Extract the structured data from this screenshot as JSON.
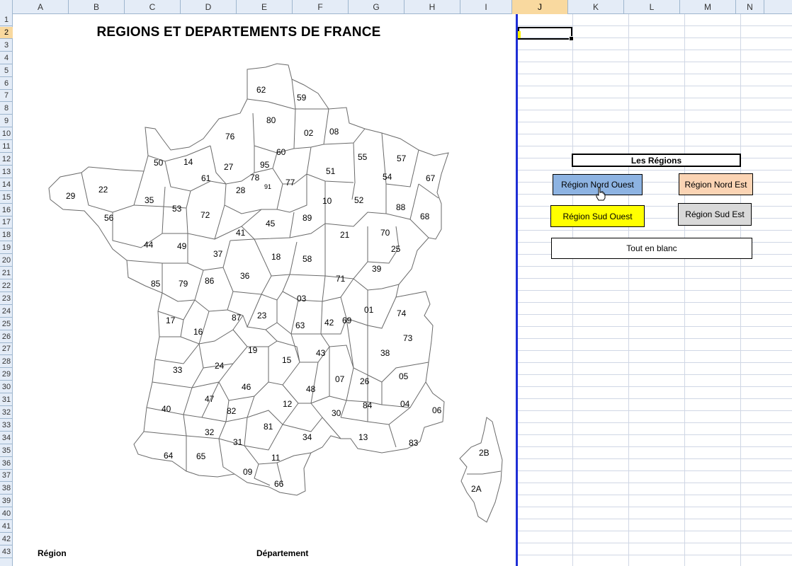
{
  "sheet": {
    "columns": [
      "A",
      "B",
      "C",
      "D",
      "E",
      "F",
      "G",
      "H",
      "I",
      "J",
      "K",
      "L",
      "M",
      "N"
    ],
    "selected_column": "J",
    "rows": [
      "1",
      "2",
      "3",
      "4",
      "5",
      "6",
      "7",
      "8",
      "9",
      "10",
      "11",
      "12",
      "13",
      "14",
      "15",
      "16",
      "17",
      "18",
      "19",
      "20",
      "21",
      "22",
      "23",
      "24",
      "25",
      "26",
      "27",
      "28",
      "29",
      "30",
      "31",
      "32",
      "33",
      "34",
      "35",
      "36",
      "37",
      "38",
      "39",
      "40",
      "41",
      "42",
      "43"
    ],
    "selected_row": "2"
  },
  "map": {
    "title": "REGIONS ET DEPARTEMENTS DE FRANCE",
    "region_label": "Région",
    "department_label": "Département",
    "departments": [
      "62",
      "59",
      "80",
      "02",
      "08",
      "76",
      "60",
      "50",
      "14",
      "27",
      "95",
      "78",
      "91",
      "77",
      "51",
      "55",
      "57",
      "54",
      "67",
      "29",
      "22",
      "61",
      "28",
      "35",
      "53",
      "72",
      "10",
      "52",
      "88",
      "68",
      "56",
      "44",
      "49",
      "41",
      "45",
      "89",
      "21",
      "70",
      "25",
      "37",
      "18",
      "58",
      "39",
      "85",
      "79",
      "86",
      "36",
      "71",
      "03",
      "01",
      "74",
      "17",
      "16",
      "87",
      "23",
      "63",
      "42",
      "69",
      "73",
      "19",
      "43",
      "38",
      "24",
      "15",
      "33",
      "46",
      "48",
      "07",
      "26",
      "05",
      "40",
      "47",
      "82",
      "12",
      "84",
      "04",
      "06",
      "32",
      "81",
      "30",
      "31",
      "34",
      "13",
      "83",
      "2B",
      "64",
      "65",
      "09",
      "11",
      "2A",
      "66"
    ]
  },
  "panel": {
    "header": "Les Régions",
    "buttons": {
      "nord_ouest": "Région Nord Ouest",
      "nord_est": "Région Nord Est",
      "sud_ouest": "Région Sud Ouest",
      "sud_est": "Région Sud Est",
      "blank": "Tout en blanc"
    },
    "colors": {
      "nord_ouest": "#8db3e2",
      "nord_est": "#fbd4b4",
      "sud_ouest": "#ffff00",
      "sud_est": "#d9d9d9",
      "selection_accent": "#fff200",
      "page_break": "#1f2fd6"
    }
  }
}
